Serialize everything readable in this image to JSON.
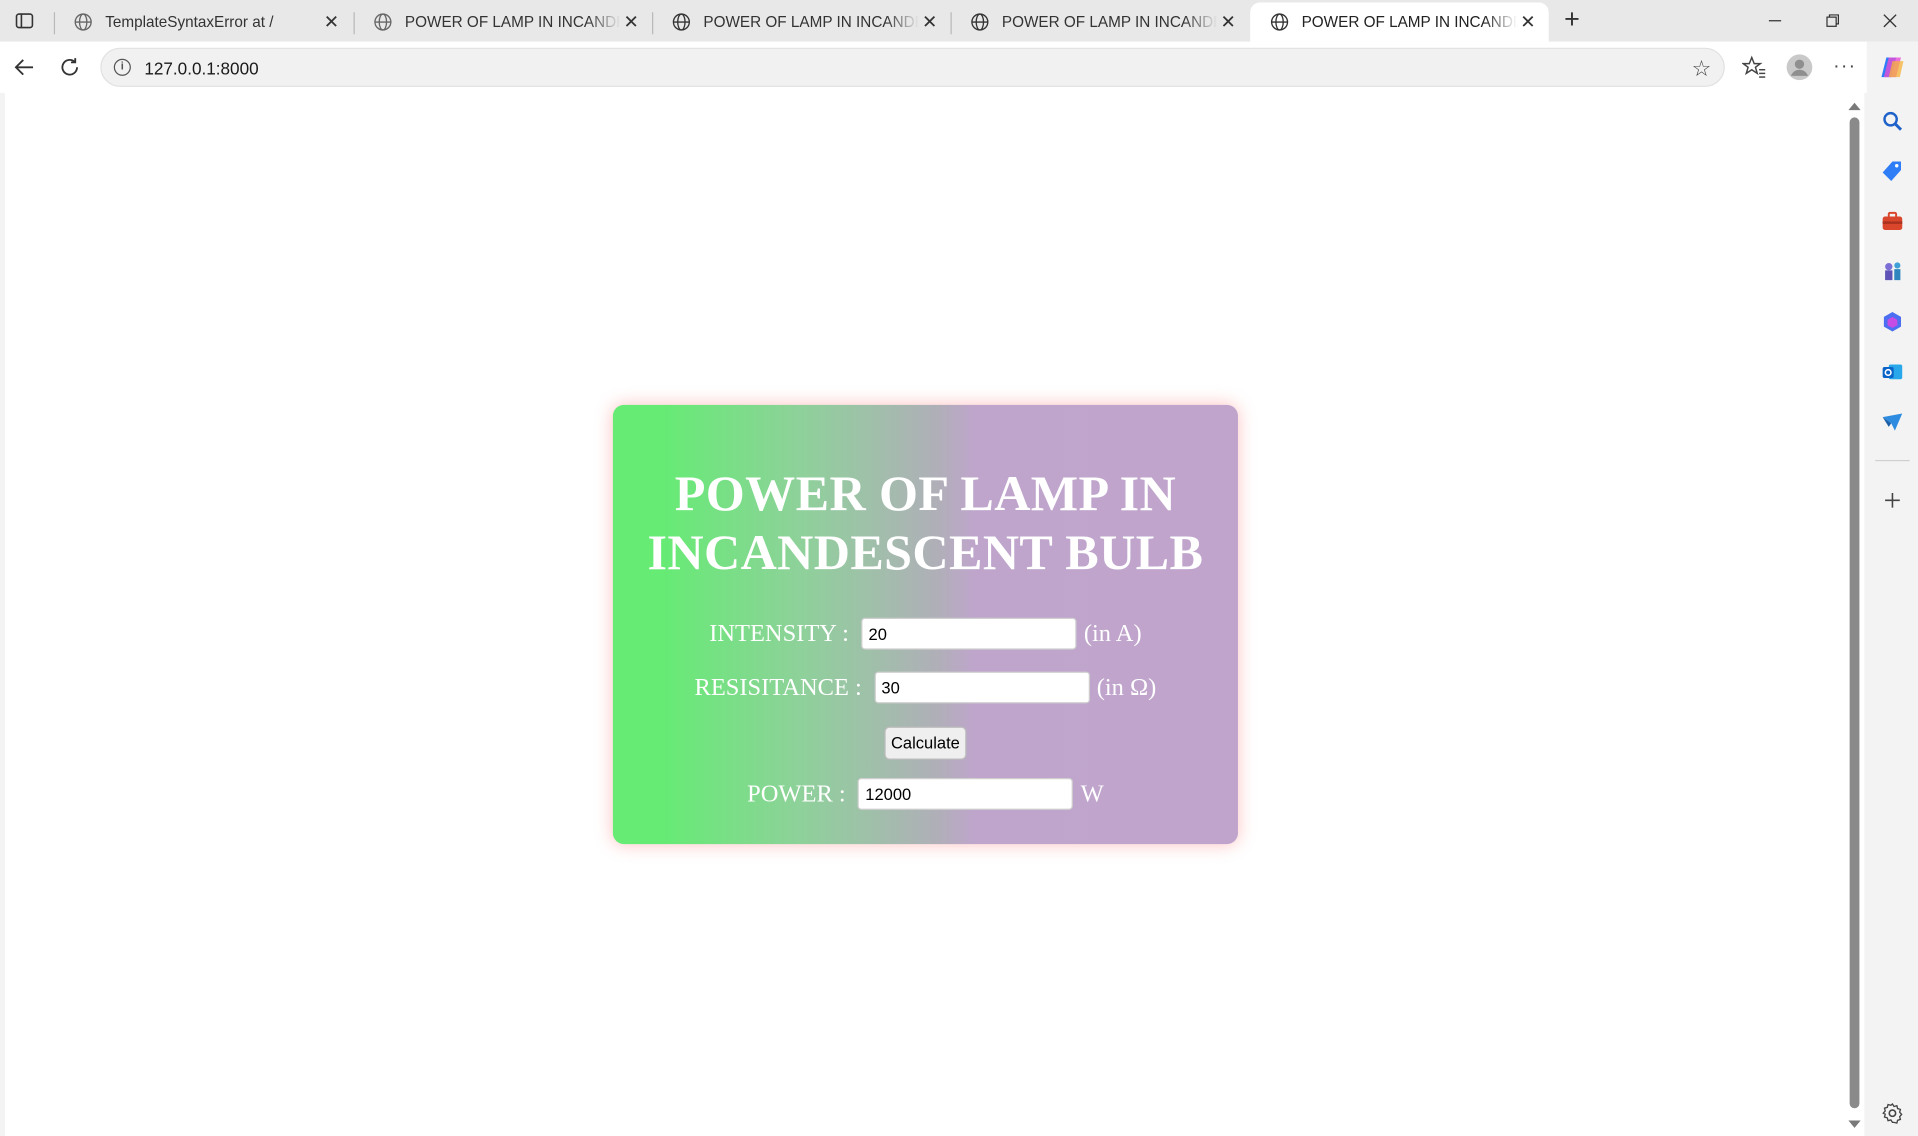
{
  "browser": {
    "tabs": [
      {
        "title": "TemplateSyntaxError at /",
        "active": false
      },
      {
        "title": "POWER OF LAMP IN INCANDESCENT BULB",
        "active": false
      },
      {
        "title": "POWER OF LAMP IN INCANDESCENT BULB",
        "active": false
      },
      {
        "title": "POWER OF LAMP IN INCANDESCENT BULB",
        "active": false
      },
      {
        "title": "POWER OF LAMP IN INCANDESCENT BULB",
        "active": true
      }
    ],
    "url": "127.0.0.1:8000"
  },
  "page": {
    "title_line1": "POWER OF LAMP IN",
    "title_line2": "INCANDESCENT BULB",
    "intensity": {
      "label": "INTENSITY :",
      "value": "20",
      "unit": "(in A)"
    },
    "resistance": {
      "label": "RESISITANCE :",
      "value": "30",
      "unit": "(in Ω)"
    },
    "calculate_label": "Calculate",
    "power": {
      "label": "POWER :",
      "value": "12000",
      "unit": "W"
    }
  },
  "colors": {
    "card_gradient_start": "#66eb74",
    "card_gradient_end": "#c0a4cc",
    "card_glow": "#ff7878"
  },
  "icons": {
    "sidebar": [
      "search-icon",
      "tag-icon",
      "briefcase-icon",
      "chess-icon",
      "copilot-hex-icon",
      "outlook-icon",
      "send-icon",
      "add-icon",
      "settings-icon"
    ]
  }
}
